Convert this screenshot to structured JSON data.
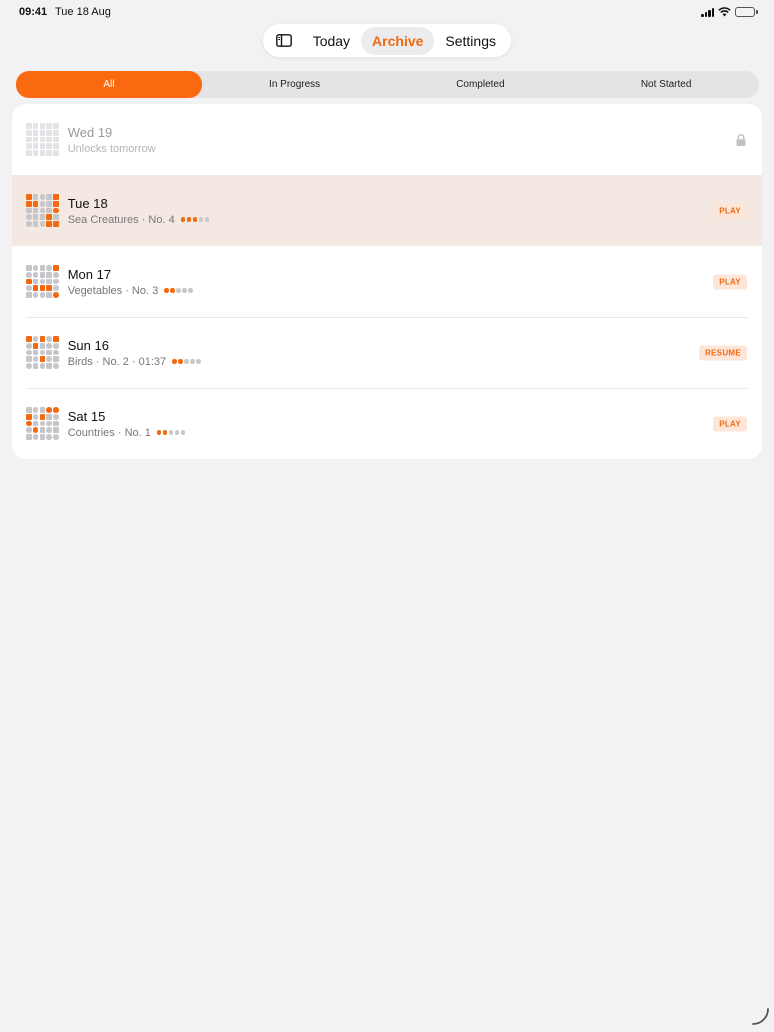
{
  "status_bar": {
    "time": "09:41",
    "date": "Tue 18 Aug"
  },
  "top_nav": {
    "tabs": [
      {
        "label": "Today",
        "active": false
      },
      {
        "label": "Archive",
        "active": true
      },
      {
        "label": "Settings",
        "active": false
      }
    ]
  },
  "filter": {
    "segments": [
      "All",
      "In Progress",
      "Completed",
      "Not Started"
    ],
    "selected": "All"
  },
  "colors": {
    "accent": "#f96a10",
    "badge_bg": "#fde6d8",
    "selected_row_bg": "#f4e8e2"
  },
  "puzzles": [
    {
      "title": "Wed 19",
      "subtitle": "Unlocks tomorrow",
      "locked": true,
      "action": "",
      "difficulty": 0
    },
    {
      "title": "Tue 18",
      "subtitle": "Sea Creatures · No. 4",
      "locked": false,
      "action": "PLAY",
      "difficulty": 3,
      "selected": true
    },
    {
      "title": "Mon 17",
      "subtitle": "Vegetables · No. 3",
      "locked": false,
      "action": "PLAY",
      "difficulty": 2
    },
    {
      "title": "Sun 16",
      "subtitle": "Birds · No. 2 · 01:37",
      "locked": false,
      "action": "RESUME",
      "difficulty": 2
    },
    {
      "title": "Sat 15",
      "subtitle": "Countries · No. 1",
      "locked": false,
      "action": "PLAY",
      "difficulty": 2
    }
  ]
}
